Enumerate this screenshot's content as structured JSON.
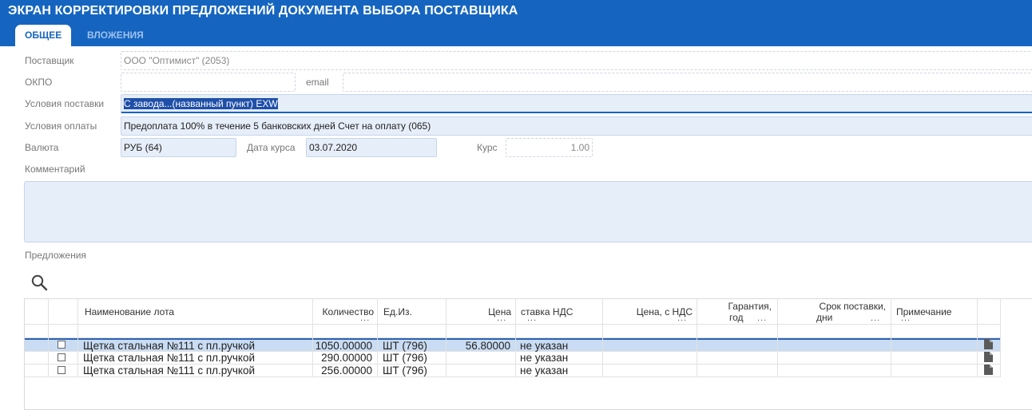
{
  "header": {
    "title": "ЭКРАН КОРРЕКТИРОВКИ ПРЕДЛОЖЕНИЙ ДОКУМЕНТА ВЫБОРА ПОСТАВЩИКА",
    "tabs": [
      {
        "label": "ОБЩЕЕ",
        "active": true
      },
      {
        "label": "ВЛОЖЕНИЯ",
        "active": false
      }
    ]
  },
  "form": {
    "supplier_label": "Поставщик",
    "supplier_value": "ООО \"Оптимист\" (2053)",
    "okpo_label": "ОКПО",
    "okpo_value": "",
    "email_label": "email",
    "email_value": "",
    "delivery_label": "Условия поставки",
    "delivery_value": "С завода...(названный пункт) EXW",
    "payment_label": "Условия оплаты",
    "payment_value": "Предоплата 100% в течение 5 банковских дней Счет на оплату (065)",
    "currency_label": "Валюта",
    "currency_value": "РУБ (64)",
    "rate_date_label": "Дата курса",
    "rate_date_value": "03.07.2020",
    "rate_label": "Курс",
    "rate_value": "1.00",
    "comment_label": "Комментарий",
    "comment_value": ""
  },
  "offers": {
    "section_label": "Предложения",
    "search_icon": "search-icon",
    "columns": {
      "name": "Наименование лота",
      "qty": "Количество",
      "unit": "Ед.Из.",
      "price": "Цена",
      "vat": "ставка НДС",
      "price_vat": "Цена, с НДС",
      "warranty_1": "Гарантия,",
      "warranty_2": "год",
      "term_1": "Срок поставки,",
      "term_2": "дни",
      "note": "Примечание",
      "ellipsis": "..."
    },
    "rows": [
      {
        "name": "Щетка стальная №111 с пл.ручкой",
        "qty": "1050.00000",
        "unit": "ШТ (796)",
        "price": "56.80000",
        "vat": "не указан",
        "selected": true
      },
      {
        "name": "Щетка стальная №111 с пл.ручкой",
        "qty": "290.00000",
        "unit": "ШТ (796)",
        "price": "",
        "vat": "не указан",
        "selected": false
      },
      {
        "name": "Щетка стальная №111 с пл.ручкой",
        "qty": "256.00000",
        "unit": "ШТ (796)",
        "price": "",
        "vat": "не указан",
        "selected": false
      }
    ]
  },
  "colors": {
    "header_bg": "#1565c0",
    "field_bg": "#e6eef9",
    "selected_row_bg": "#c9dcf3"
  }
}
